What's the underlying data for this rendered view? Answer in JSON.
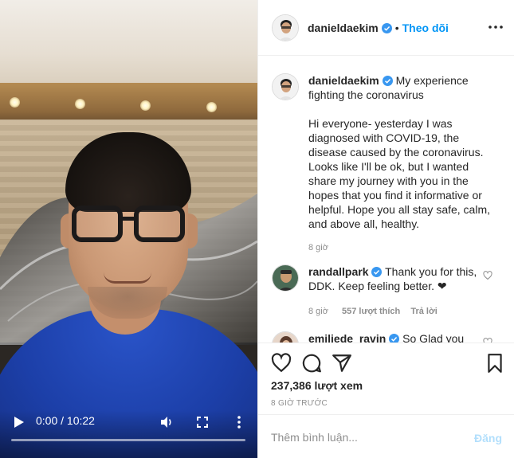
{
  "video": {
    "time_display": "0:00 / 10:22",
    "progress": 0
  },
  "header": {
    "username": "danieldaekim",
    "separator": "•",
    "follow_label": "Theo dõi"
  },
  "caption": {
    "username": "danieldaekim",
    "title": "My experience fighting the coronavirus",
    "body": "Hi everyone- yesterday I was diagnosed with COVID-19, the disease caused by the coronavirus. Looks like I'll be ok, but I wanted share my journey with you in the hopes that you find it informative or helpful. Hope you all stay safe, calm, and above all, healthy.",
    "time": "8 giờ"
  },
  "comments": [
    {
      "username": "randallpark",
      "text": "Thank you for this, DDK. Keep feeling better. ❤",
      "time": "8 giờ",
      "likes": "557 lượt thích",
      "reply_label": "Trả lời"
    },
    {
      "username": "emiliede_ravin",
      "text": "So Glad you"
    }
  ],
  "stats": {
    "views": "237,386 lượt xem",
    "posted": "8 GIỜ TRƯỚC"
  },
  "add_comment": {
    "placeholder": "Thêm bình luận...",
    "post_label": "Đăng"
  },
  "colors": {
    "link_blue": "#0095f6",
    "post_disabled": "#b2dffc",
    "muted": "#8e8e8e",
    "verified": "#3897f0"
  }
}
